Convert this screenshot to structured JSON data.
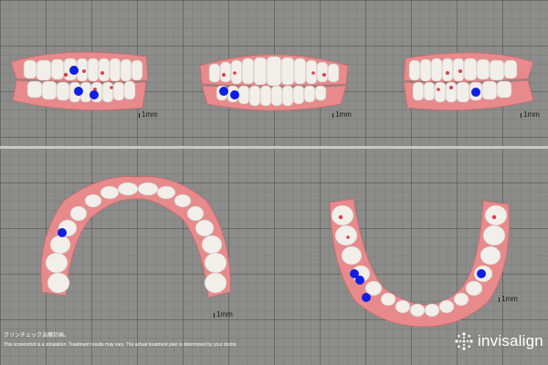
{
  "viewer": {
    "background": "#8c8c8a",
    "attachment_color": "#1020e0",
    "gum_color": "#e88a8c",
    "tooth_color": "#f2eeea",
    "scale_label": "1mm"
  },
  "views": [
    {
      "name": "right-buccal-view",
      "scale_label": "1mm"
    },
    {
      "name": "anterior-view",
      "scale_label": "1mm"
    },
    {
      "name": "left-buccal-view",
      "scale_label": "1mm"
    },
    {
      "name": "maxillary-occlusal-view",
      "scale_label": "1mm"
    },
    {
      "name": "mandibular-occlusal-view",
      "scale_label": "1mm"
    }
  ],
  "footer": {
    "title": "クリンチェック治療計画。",
    "disclaimer": "This screenshot is a simulation. Treatment results may vary. The actual treatment plan is determined by your doctor."
  },
  "brand": {
    "name": "invisalign",
    "logo_icon": "invisalign-star-icon"
  }
}
